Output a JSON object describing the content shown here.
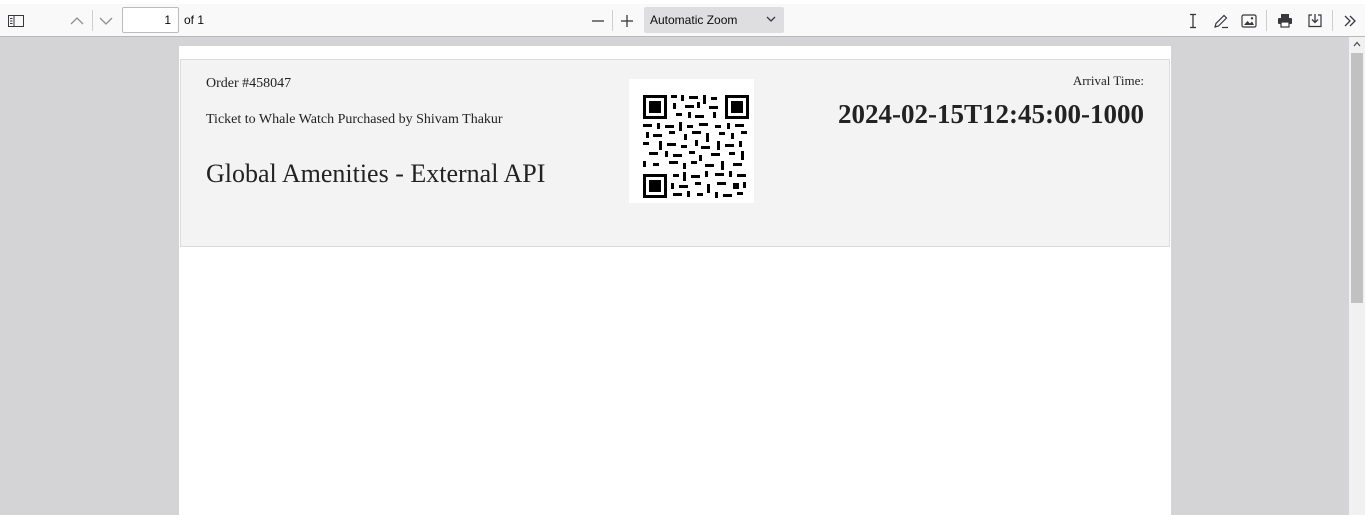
{
  "toolbar": {
    "page_number": "1",
    "page_count_label": "of 1",
    "zoom_label": "Automatic Zoom",
    "icons": [
      "sidebar-toggle-icon",
      "page-up-icon",
      "page-down-icon",
      "zoom-out-icon",
      "zoom-in-icon",
      "chevron-down-icon",
      "text-cursor-icon",
      "pen-icon",
      "image-icon",
      "printer-icon",
      "save-icon",
      "double-chevron-right-icon"
    ]
  },
  "document": {
    "order": "Order #458047",
    "description": "Ticket to Whale Watch Purchased by Shivam Thakur",
    "company": "Global Amenities - External API",
    "arrival_label": "Arrival Time:",
    "arrival_time": "2024-02-15T12:45:00-1000"
  },
  "colors": {
    "toolbar_bg": "#f9f9fa",
    "viewer_bg": "#d4d4d7",
    "ticket_bg": "#f3f3f3",
    "zoom_bg": "#dedee1"
  }
}
